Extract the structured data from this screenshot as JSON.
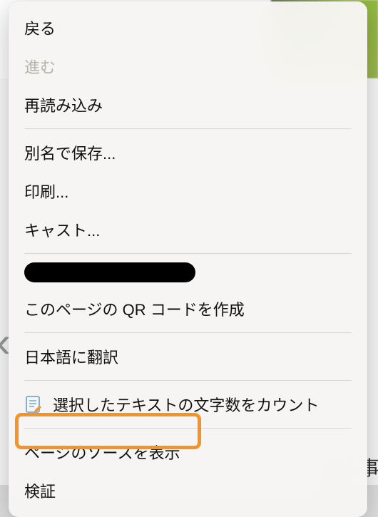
{
  "menu": {
    "back": "戻る",
    "forward": "進む",
    "reload": "再読み込み",
    "save_as": "別名で保存...",
    "print": "印刷...",
    "cast": "キャスト...",
    "qr": "このページの QR コードを作成",
    "translate": "日本語に翻訳",
    "count_chars": "選択したテキストの文字数をカウント",
    "view_source": "ページのソースを表示",
    "inspect": "検証"
  },
  "bg": {
    "left_glyph": "‹",
    "bottom_right": "個人事業",
    "bottom_dots": "・・"
  }
}
